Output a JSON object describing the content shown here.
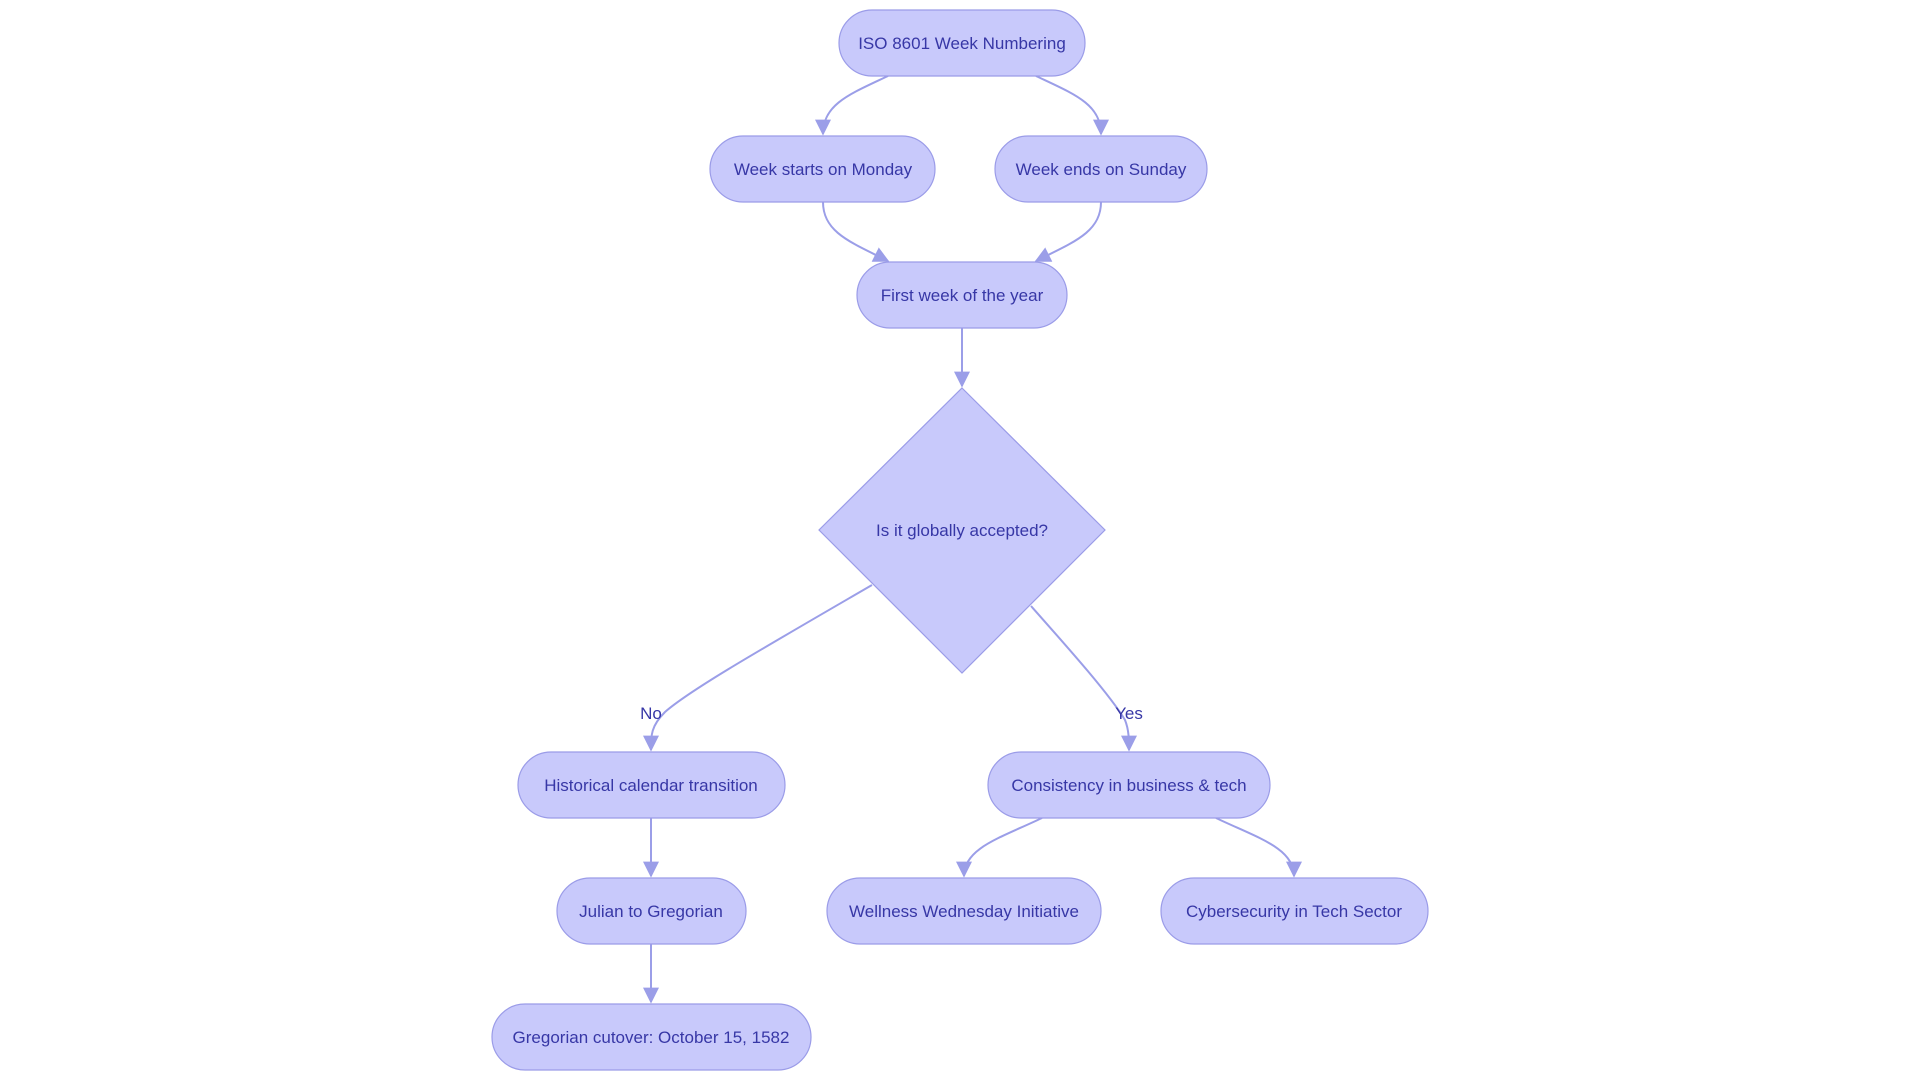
{
  "diagram": {
    "type": "flowchart",
    "colors": {
      "node_fill": "#c8c9fb",
      "node_stroke": "#9b9ce8",
      "edge": "#9b9ee8",
      "text": "#3737a6",
      "background": "#ffffff"
    },
    "nodes": {
      "iso": {
        "label": "ISO 8601 Week Numbering",
        "shape": "stadium"
      },
      "monday": {
        "label": "Week starts on Monday",
        "shape": "stadium"
      },
      "sunday": {
        "label": "Week ends on Sunday",
        "shape": "stadium"
      },
      "first_week": {
        "label": "First week of the year",
        "shape": "stadium"
      },
      "decision": {
        "label": "Is it globally accepted?",
        "shape": "diamond"
      },
      "historical": {
        "label": "Historical calendar transition",
        "shape": "stadium"
      },
      "consistency": {
        "label": "Consistency in business & tech",
        "shape": "stadium"
      },
      "julian": {
        "label": "Julian to Gregorian",
        "shape": "stadium"
      },
      "wellness": {
        "label": "Wellness Wednesday Initiative",
        "shape": "stadium"
      },
      "cyber": {
        "label": "Cybersecurity in Tech Sector",
        "shape": "stadium"
      },
      "cutover": {
        "label": "Gregorian cutover: October 15, 1582",
        "shape": "stadium"
      }
    },
    "edges": [
      {
        "from": "iso",
        "to": "monday",
        "label": ""
      },
      {
        "from": "iso",
        "to": "sunday",
        "label": ""
      },
      {
        "from": "monday",
        "to": "first_week",
        "label": ""
      },
      {
        "from": "sunday",
        "to": "first_week",
        "label": ""
      },
      {
        "from": "first_week",
        "to": "decision",
        "label": ""
      },
      {
        "from": "decision",
        "to": "historical",
        "label": "No"
      },
      {
        "from": "decision",
        "to": "consistency",
        "label": "Yes"
      },
      {
        "from": "historical",
        "to": "julian",
        "label": ""
      },
      {
        "from": "consistency",
        "to": "wellness",
        "label": ""
      },
      {
        "from": "consistency",
        "to": "cyber",
        "label": ""
      },
      {
        "from": "julian",
        "to": "cutover",
        "label": ""
      }
    ],
    "edge_labels": {
      "no": "No",
      "yes": "Yes"
    }
  }
}
